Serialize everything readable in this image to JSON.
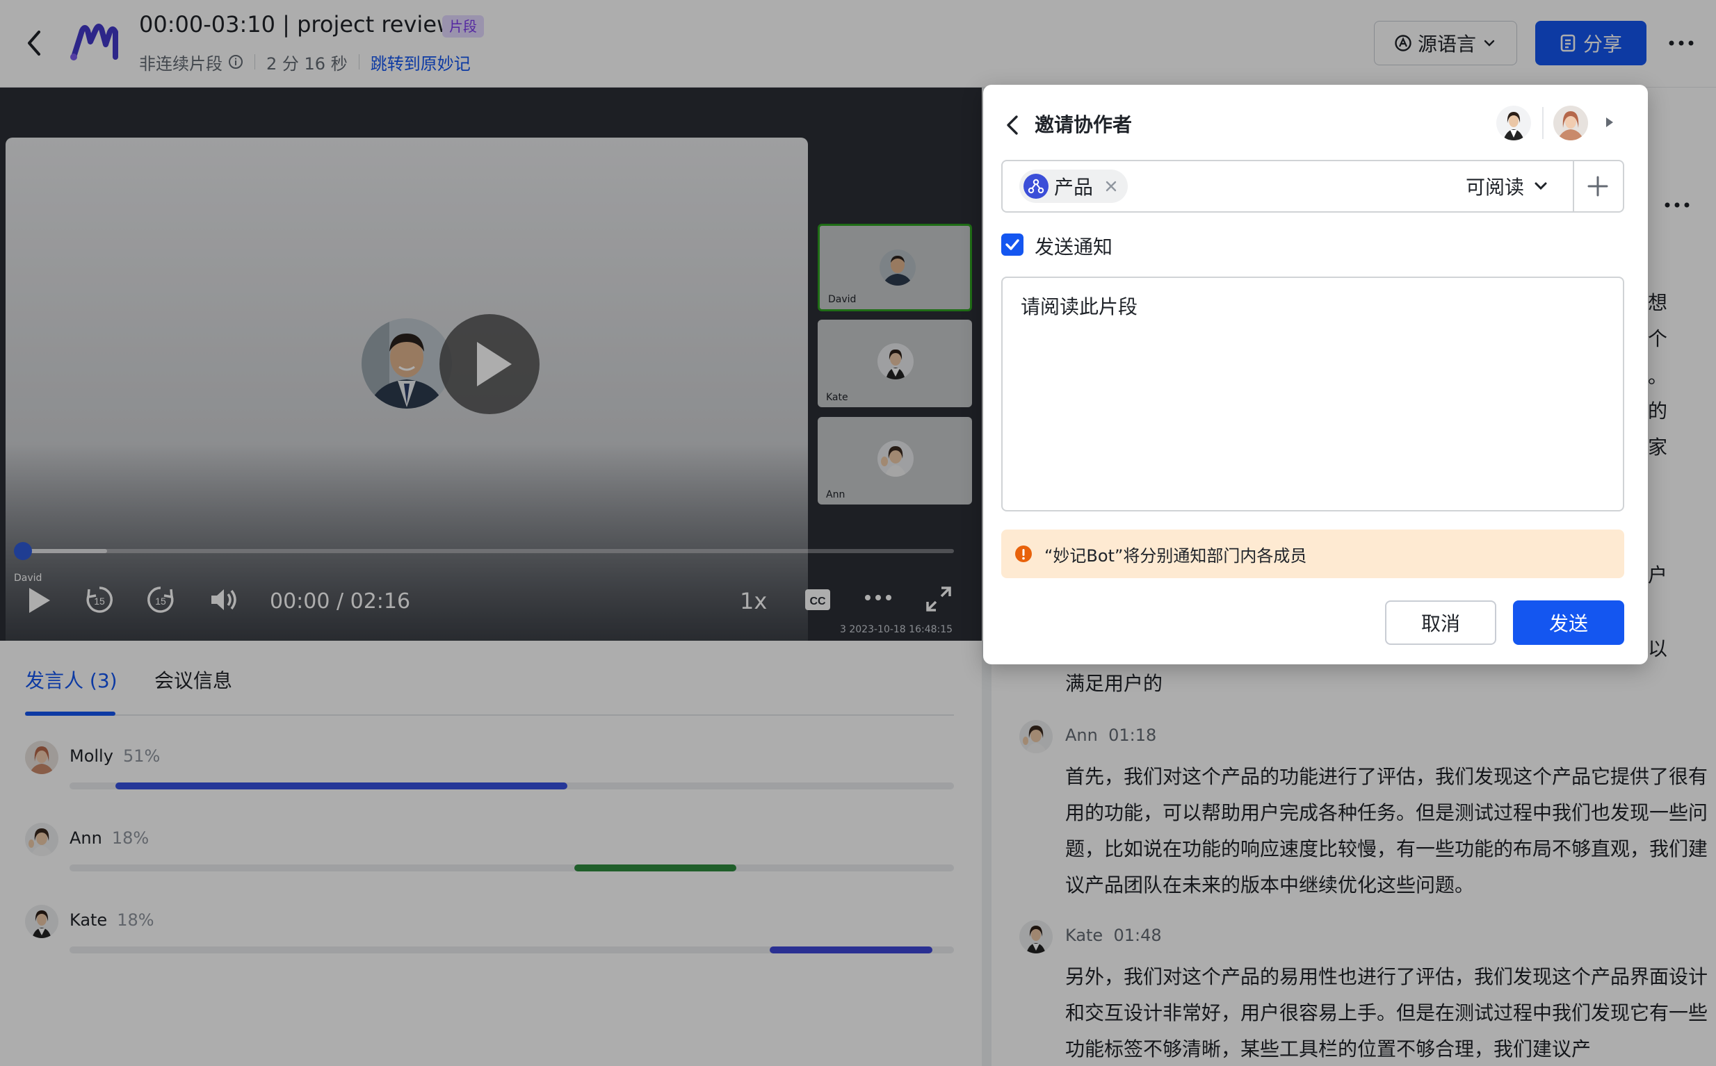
{
  "header": {
    "title": "00:00-03:10 | project review",
    "tag": "片段",
    "subtitle_clip_type": "非连续片段",
    "duration": "2 分 16 秒",
    "jump_link": "跳转到原妙记",
    "language_button": "源语言",
    "share_button": "分享"
  },
  "video": {
    "time": "00:00 / 02:16",
    "speed": "1x",
    "cc": "CC",
    "skip_seconds": "15",
    "progress_fraction": 0.0,
    "knob_label": "David",
    "watermark": "3  2023-10-18 16:48:15",
    "thumbnails": [
      {
        "name": "David",
        "active": true
      },
      {
        "name": "Kate",
        "active": false
      },
      {
        "name": "Ann",
        "active": false
      }
    ]
  },
  "tabs": {
    "speakers": "发言人 (3)",
    "meeting_info": "会议信息"
  },
  "speakers": [
    {
      "name": "Molly",
      "pct": "51%",
      "segment_start": 0.052,
      "segment_end": 0.563,
      "color": "#3752e0"
    },
    {
      "name": "Ann",
      "pct": "18%",
      "segment_start": 0.571,
      "segment_end": 0.754,
      "color": "#2e8b3e"
    },
    {
      "name": "Kate",
      "pct": "18%",
      "segment_start": 0.792,
      "segment_end": 0.976,
      "color": "#3f48d8"
    }
  ],
  "transcript": {
    "partial_lines": [
      "满足用户的"
    ],
    "side_fragments": [
      "想",
      "个",
      "。",
      "的",
      "家",
      "户",
      "以"
    ],
    "entries": [
      {
        "speaker": "Ann",
        "time": "01:18",
        "text": "首先，我们对这个产品的功能进行了评估，我们发现这个产品它提供了很有用的功能，可以帮助用户完成各种任务。但是测试过程中我们也发现一些问题，比如说在功能的响应速度比较慢，有一些功能的布局不够直观，我们建议产品团队在未来的版本中继续优化这些问题。"
      },
      {
        "speaker": "Kate",
        "time": "01:48",
        "text": "另外，我们对这个产品的易用性也进行了评估，我们发现这个产品界面设计和交互设计非常好，用户很容易上手。但是在测试过程中我们发现它有一些功能标签不够清晰，某些工具栏的位置不够合理，我们建议产"
      }
    ]
  },
  "dialog": {
    "title": "邀请协作者",
    "chip_label": "产品",
    "permission": "可阅读",
    "notify_label": "发送通知",
    "notify_checked": true,
    "message": "请阅读此片段",
    "alert": "“妙记Bot”将分别通知部门内各成员",
    "cancel": "取消",
    "send": "发送"
  },
  "colors": {
    "primary": "#1456f0",
    "tag_bg": "#e3d9ff",
    "alert_bg": "#feead2",
    "alert_icon": "#e8620b",
    "active_thumb_border": "#2ea121"
  }
}
